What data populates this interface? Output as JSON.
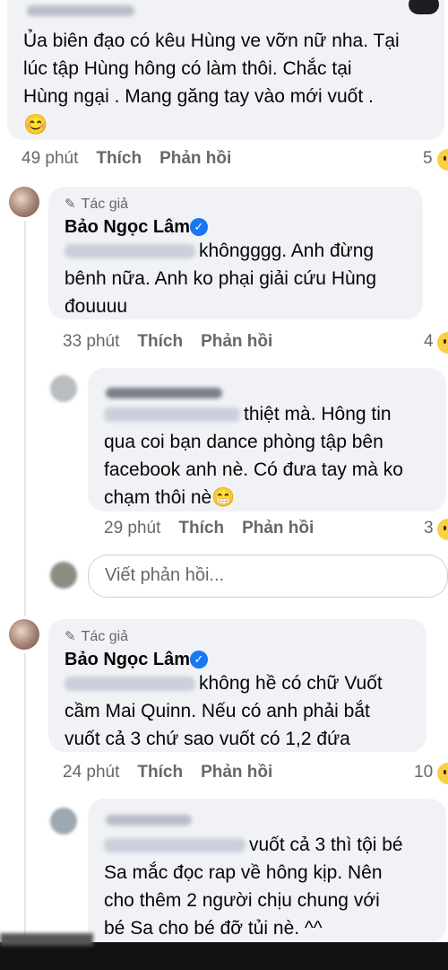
{
  "comment1": {
    "text_lines": [
      "Ủa biên đạo có kêu Hùng ve vỡn nữ nha. Tại",
      "lúc tập Hùng hông có làm thôi. Chắc tại",
      "Hùng ngại . Mang găng tay vào mới vuốt ."
    ],
    "emoji": "😊",
    "time": "49 phút",
    "like": "Thích",
    "reply": "Phản hồi",
    "reactions": "5"
  },
  "comment2": {
    "badge": "Tác giả",
    "author": "Bảo Ngọc Lâm",
    "line1": "khôngggg. Anh đừng",
    "line2": "bênh nữa. Anh ko phại giải cứu Hùng",
    "line3": "đouuuu",
    "time": "33 phút",
    "like": "Thích",
    "reply": "Phản hồi",
    "reactions": "4"
  },
  "comment3": {
    "line1": "thiệt mà. Hông tin",
    "line2": "qua coi bạn dance phòng tập bên",
    "line3": "facebook anh nè. Có đưa tay mà ko",
    "line4": "chạm thôi nè",
    "emoji": "😁",
    "time": "29 phút",
    "like": "Thích",
    "reply": "Phản hồi",
    "reactions": "3"
  },
  "reply_box": {
    "placeholder": "Viết phản hồi..."
  },
  "comment4": {
    "badge": "Tác giả",
    "author": "Bảo Ngọc Lâm",
    "line1": "không hề có chữ Vuốt",
    "line2": "cầm Mai Quinn. Nếu có anh phải bắt",
    "line3": "vuốt cả 3 chứ sao vuốt có 1,2 đứa",
    "time": "24 phút",
    "like": "Thích",
    "reply": "Phản hồi",
    "reactions": "10"
  },
  "comment5": {
    "line1": "vuốt cả 3 thì tội bé",
    "line2": "Sa mắc đọc rap về hông kịp.  Nên",
    "line3": "cho thêm 2 người chịu chung với",
    "line4": "bé Sa cho bé đỡ tủi nè. ^^"
  },
  "colors": {
    "bubble": "#f0f2f5",
    "meta_text": "#65676b",
    "verified": "#1877f2"
  }
}
